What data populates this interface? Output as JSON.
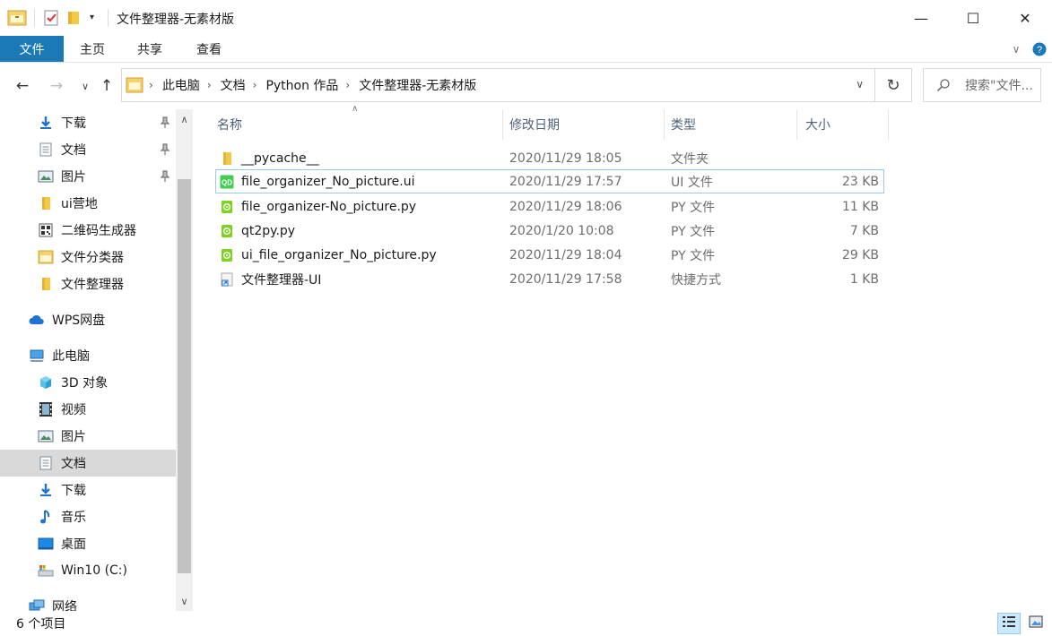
{
  "window": {
    "title": "文件整理器-无素材版",
    "minimize_icon": "—",
    "maximize_icon": "☐",
    "close_icon": "✕"
  },
  "ribbon": {
    "tabs": [
      "文件",
      "主页",
      "共享",
      "查看"
    ]
  },
  "address": {
    "crumbs": [
      "此电脑",
      "文档",
      "Python 作品",
      "文件整理器-无素材版"
    ],
    "search_placeholder": "搜索\"文件..."
  },
  "sidebar": {
    "items": [
      {
        "label": "下载",
        "icon": "download-icon",
        "pinned": true
      },
      {
        "label": "文档",
        "icon": "document-icon",
        "pinned": true
      },
      {
        "label": "图片",
        "icon": "picture-icon",
        "pinned": true
      },
      {
        "label": "ui营地",
        "icon": "folder-icon",
        "pinned": false
      },
      {
        "label": "二维码生成器",
        "icon": "qrcode-icon",
        "pinned": false
      },
      {
        "label": "文件分类器",
        "icon": "folder-icon",
        "pinned": false
      },
      {
        "label": "文件整理器",
        "icon": "folder-icon",
        "pinned": false
      },
      {
        "label": "WPS网盘",
        "icon": "cloud-icon",
        "pinned": false
      },
      {
        "label": "此电脑",
        "icon": "computer-icon",
        "pinned": false
      },
      {
        "label": "3D 对象",
        "icon": "cube-icon",
        "pinned": false
      },
      {
        "label": "视频",
        "icon": "video-icon",
        "pinned": false
      },
      {
        "label": "图片",
        "icon": "picture-icon",
        "pinned": false
      },
      {
        "label": "文档",
        "icon": "document-icon",
        "pinned": false
      },
      {
        "label": "下载",
        "icon": "download-icon",
        "pinned": false
      },
      {
        "label": "音乐",
        "icon": "music-icon",
        "pinned": false
      },
      {
        "label": "桌面",
        "icon": "desktop-icon",
        "pinned": false
      },
      {
        "label": "Win10 (C:)",
        "icon": "drive-icon",
        "pinned": false
      },
      {
        "label": "网络",
        "icon": "network-icon",
        "pinned": false
      }
    ],
    "selected": "文档"
  },
  "columns": {
    "name": "名称",
    "date": "修改日期",
    "type": "类型",
    "size": "大小"
  },
  "files": [
    {
      "name": "__pycache__",
      "date": "2020/11/29 18:05",
      "type": "文件夹",
      "size": "",
      "icon": "folder-icon"
    },
    {
      "name": "file_organizer_No_picture.ui",
      "date": "2020/11/29 17:57",
      "type": "UI 文件",
      "size": "23 KB",
      "icon": "qt-designer-icon"
    },
    {
      "name": "file_organizer-No_picture.py",
      "date": "2020/11/29 18:06",
      "type": "PY 文件",
      "size": "11 KB",
      "icon": "python-file-icon"
    },
    {
      "name": "qt2py.py",
      "date": "2020/1/20 10:08",
      "type": "PY 文件",
      "size": "7 KB",
      "icon": "python-file-icon"
    },
    {
      "name": "ui_file_organizer_No_picture.py",
      "date": "2020/11/29 18:04",
      "type": "PY 文件",
      "size": "29 KB",
      "icon": "python-file-icon"
    },
    {
      "name": "文件整理器-UI",
      "date": "2020/11/29 17:58",
      "type": "快捷方式",
      "size": "1 KB",
      "icon": "shortcut-icon"
    }
  ],
  "status": {
    "item_count": "6 个项目"
  },
  "colors": {
    "file_tab": "#1a79b6",
    "selection": "#d9d9d9",
    "hover_border": "#99c9ef",
    "header_text": "#4c607a"
  }
}
